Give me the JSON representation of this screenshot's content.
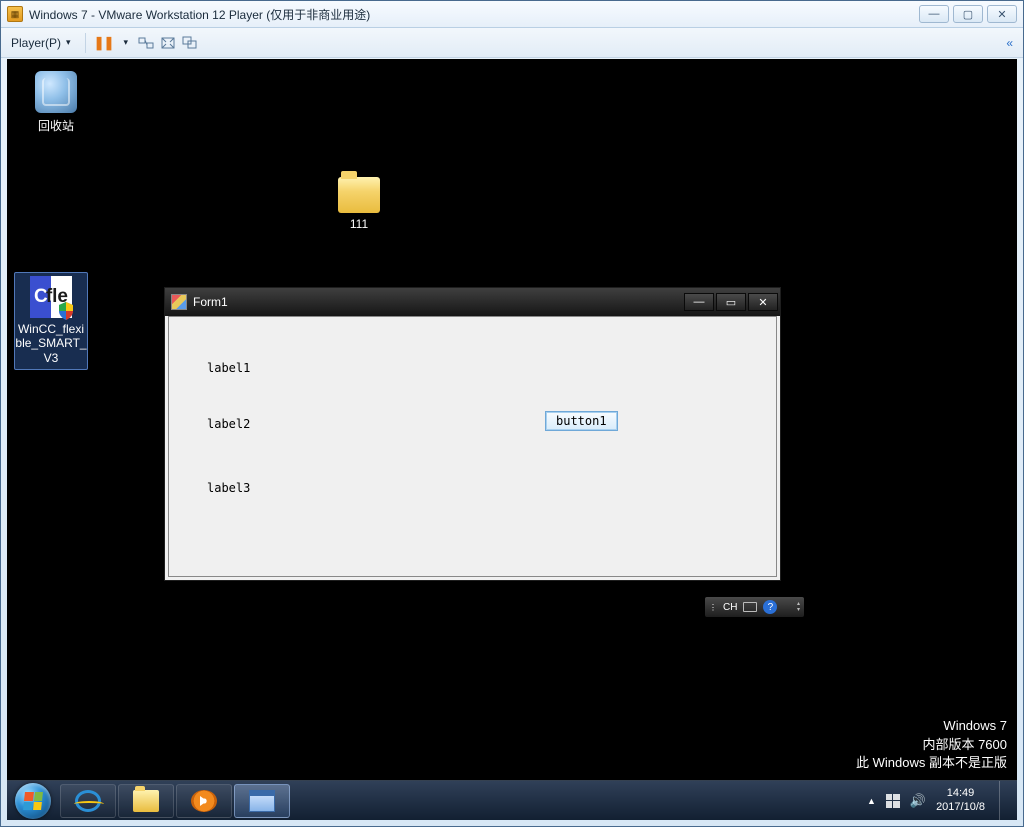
{
  "vmware": {
    "title": "Windows 7 - VMware Workstation 12 Player (仅用于非商业用途)",
    "player_menu": "Player(P)",
    "win_min": "—",
    "win_max": "▢",
    "win_close": "✕",
    "collapse": "«"
  },
  "desktop": {
    "recycle_bin": "回收站",
    "folder_111": "111",
    "wincc": "WinCC_flexible_SMART_V3"
  },
  "form1": {
    "title": "Form1",
    "label1": "label1",
    "label2": "label2",
    "label3": "label3",
    "button1": "button1",
    "min": "—",
    "max": "▭",
    "close": "✕"
  },
  "ime": {
    "lang": "CH",
    "help": "?"
  },
  "watermark": {
    "line1": "Windows 7",
    "line2": "内部版本 7600",
    "line3": "此 Windows 副本不是正版"
  },
  "tray": {
    "up": "▲",
    "time": "14:49",
    "date": "2017/10/8"
  }
}
